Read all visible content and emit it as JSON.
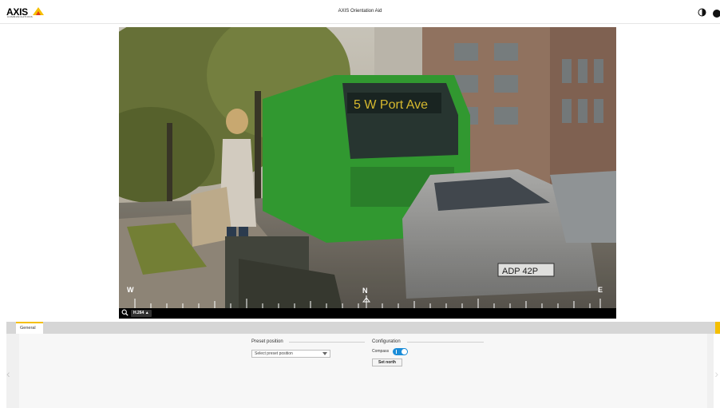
{
  "header": {
    "logo_text": "AXIS",
    "logo_subtext": "COMMUNICATIONS",
    "app_title": "AXIS Orientation Aid"
  },
  "video": {
    "bus_sign": "5 W Port Ave",
    "plate": "ADP 42P",
    "compass": {
      "west": "W",
      "north": "N",
      "east": "E"
    },
    "codec": "H.264 ▲"
  },
  "tabs": [
    {
      "label": "General",
      "active": true
    }
  ],
  "preset": {
    "title": "Preset position",
    "select_value": "Select preset position"
  },
  "configuration": {
    "title": "Configuration",
    "compass_label": "Compass",
    "compass_enabled": true,
    "set_north_label": "Set north"
  },
  "colors": {
    "accent": "#f5bf00",
    "toggle": "#1a8cd8"
  },
  "icons": [
    "contrast-icon",
    "zoom-icon",
    "chevron-left-icon",
    "chevron-right-icon"
  ]
}
